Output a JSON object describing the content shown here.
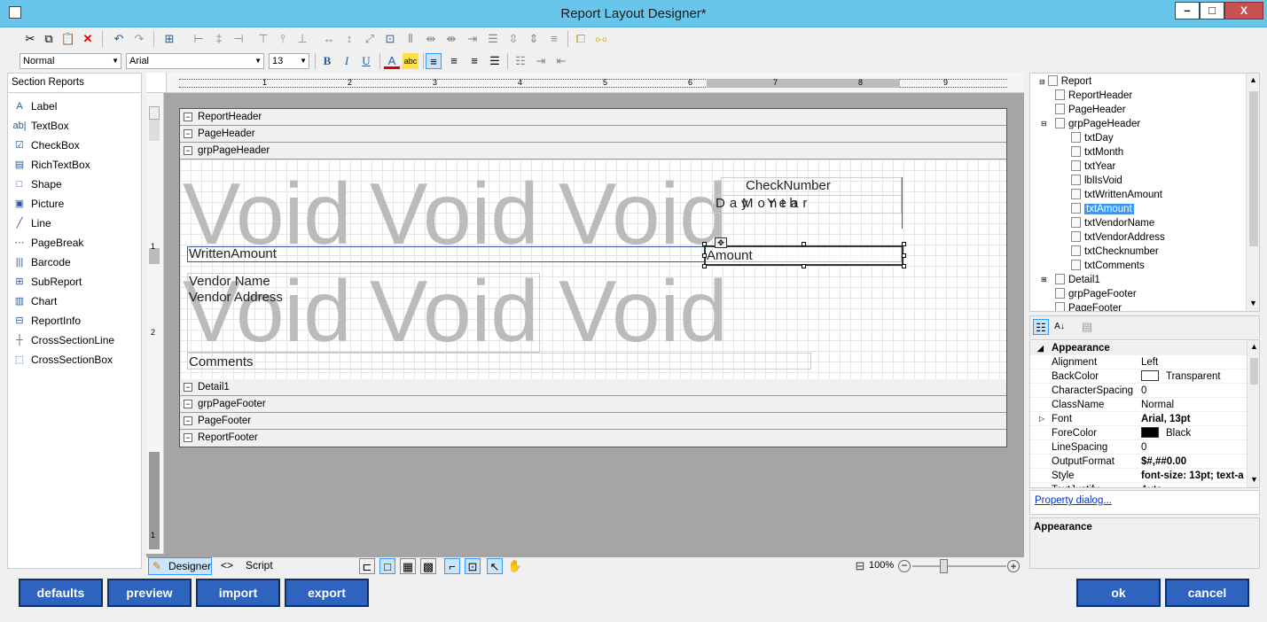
{
  "window": {
    "title": "Report Layout Designer*",
    "minimize": "–",
    "maximize": "□",
    "close": "X"
  },
  "format": {
    "style": "Normal",
    "font": "Arial",
    "size": "13"
  },
  "toolbox": {
    "header": "Section Reports",
    "items": [
      {
        "label": "Label",
        "icon": "label-icon"
      },
      {
        "label": "TextBox",
        "icon": "textbox-icon"
      },
      {
        "label": "CheckBox",
        "icon": "checkbox-icon"
      },
      {
        "label": "RichTextBox",
        "icon": "richtextbox-icon"
      },
      {
        "label": "Shape",
        "icon": "shape-icon"
      },
      {
        "label": "Picture",
        "icon": "picture-icon"
      },
      {
        "label": "Line",
        "icon": "line-icon"
      },
      {
        "label": "PageBreak",
        "icon": "pagebreak-icon"
      },
      {
        "label": "Barcode",
        "icon": "barcode-icon"
      },
      {
        "label": "SubReport",
        "icon": "subreport-icon"
      },
      {
        "label": "Chart",
        "icon": "chart-icon"
      },
      {
        "label": "ReportInfo",
        "icon": "reportinfo-icon"
      },
      {
        "label": "CrossSectionLine",
        "icon": "crosssectionline-icon"
      },
      {
        "label": "CrossSectionBox",
        "icon": "crosssectionbox-icon"
      }
    ]
  },
  "ruler": {
    "marks": [
      "1",
      "2",
      "3",
      "4",
      "5",
      "6",
      "7",
      "8",
      "9"
    ],
    "vmarks": [
      "1",
      "2",
      "1"
    ]
  },
  "bands": {
    "reportHeader": "ReportHeader",
    "pageHeader": "PageHeader",
    "grpPageHeader": "grpPageHeader",
    "detail": "Detail1",
    "grpPageFooter": "grpPageFooter",
    "pageFooter": "PageFooter",
    "reportFooter": "ReportFooter"
  },
  "fields": {
    "void": "Void",
    "checkNumber": "CheckNumber",
    "day": "Day",
    "month": "Month",
    "year": "Year",
    "writtenAmount": "WrittenAmount",
    "amount": "Amount",
    "vendorName": "Vendor Name",
    "vendorAddress": "Vendor Address",
    "comments": "Comments"
  },
  "tabs": {
    "designer": "Designer",
    "script": "Script"
  },
  "zoom": "100%",
  "explorer": {
    "root": "Report",
    "items": [
      "ReportHeader",
      "PageHeader",
      "grpPageHeader",
      "txtDay",
      "txtMonth",
      "txtYear",
      "lblIsVoid",
      "txtWrittenAmount",
      "txtAmount",
      "txtVendorName",
      "txtVendorAddress",
      "txtChecknumber",
      "txtComments",
      "Detail1",
      "grpPageFooter",
      "PageFooter"
    ],
    "selected": "txtAmount"
  },
  "properties": {
    "category": "Appearance",
    "rows": [
      {
        "name": "Alignment",
        "value": "Left"
      },
      {
        "name": "BackColor",
        "value": "Transparent"
      },
      {
        "name": "CharacterSpacing",
        "value": "0"
      },
      {
        "name": "ClassName",
        "value": "Normal"
      },
      {
        "name": "Font",
        "value": "Arial, 13pt"
      },
      {
        "name": "ForeColor",
        "value": "Black"
      },
      {
        "name": "LineSpacing",
        "value": "0"
      },
      {
        "name": "OutputFormat",
        "value": "$#,##0.00"
      },
      {
        "name": "Style",
        "value": "font-size: 13pt; text-a"
      },
      {
        "name": "TextJustify",
        "value": "Auto"
      }
    ],
    "link": "Property dialog...",
    "description": "Appearance"
  },
  "buttons": {
    "defaults": "defaults",
    "preview": "preview",
    "import": "import",
    "export": "export",
    "ok": "ok",
    "cancel": "cancel"
  },
  "colors": {
    "titlebar": "#67c6ea",
    "button": "#2e64c0",
    "selection": "#3399ff"
  }
}
